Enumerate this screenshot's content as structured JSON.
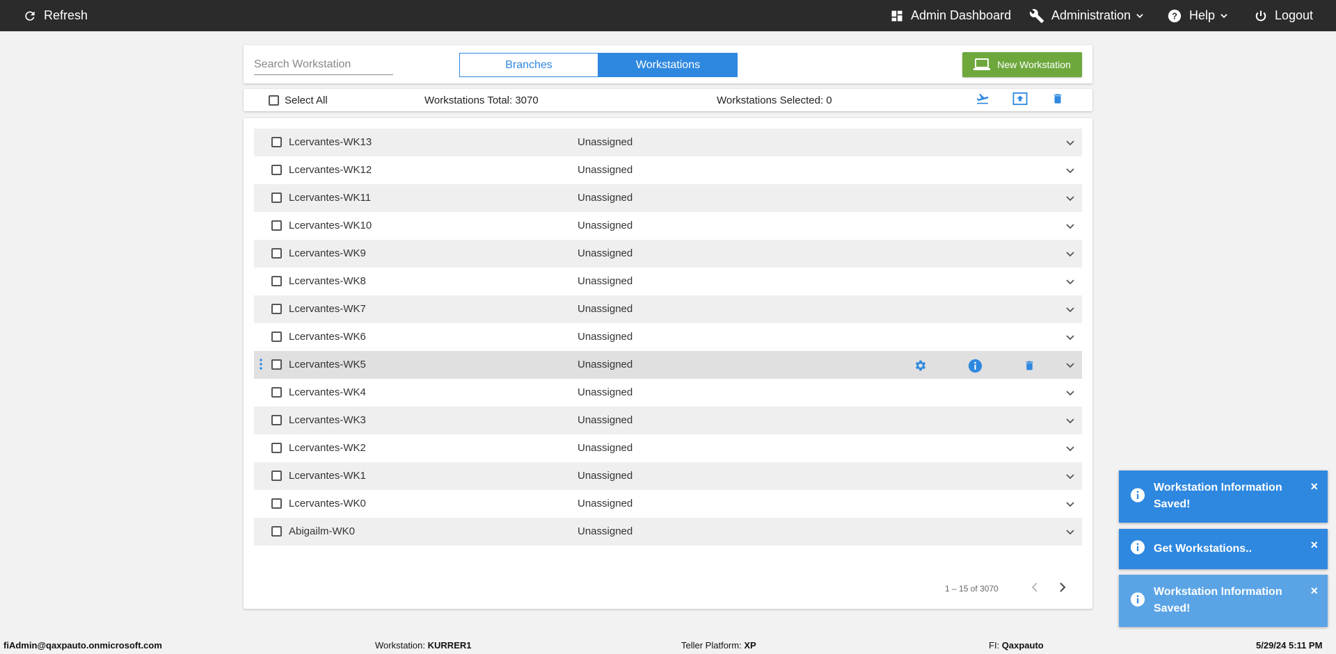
{
  "topbar": {
    "refresh_label": "Refresh",
    "admin_dashboard_label": "Admin Dashboard",
    "administration_label": "Administration",
    "help_label": "Help",
    "logout_label": "Logout"
  },
  "toolbar": {
    "search_placeholder": "Search Workstation",
    "branches_tab": "Branches",
    "workstations_tab": "Workstations",
    "active_tab": "Workstations",
    "new_workstation_label": "New Workstation"
  },
  "selection": {
    "select_all_label": "Select All",
    "total_label": "Workstations Total: 3070",
    "selected_label": "Workstations Selected: 0"
  },
  "rows": [
    {
      "name": "Lcervantes-WK13",
      "assignment": "Unassigned"
    },
    {
      "name": "Lcervantes-WK12",
      "assignment": "Unassigned"
    },
    {
      "name": "Lcervantes-WK11",
      "assignment": "Unassigned"
    },
    {
      "name": "Lcervantes-WK10",
      "assignment": "Unassigned"
    },
    {
      "name": "Lcervantes-WK9",
      "assignment": "Unassigned"
    },
    {
      "name": "Lcervantes-WK8",
      "assignment": "Unassigned"
    },
    {
      "name": "Lcervantes-WK7",
      "assignment": "Unassigned"
    },
    {
      "name": "Lcervantes-WK6",
      "assignment": "Unassigned"
    },
    {
      "name": "Lcervantes-WK5",
      "assignment": "Unassigned"
    },
    {
      "name": "Lcervantes-WK4",
      "assignment": "Unassigned"
    },
    {
      "name": "Lcervantes-WK3",
      "assignment": "Unassigned"
    },
    {
      "name": "Lcervantes-WK2",
      "assignment": "Unassigned"
    },
    {
      "name": "Lcervantes-WK1",
      "assignment": "Unassigned"
    },
    {
      "name": "Lcervantes-WK0",
      "assignment": "Unassigned"
    },
    {
      "name": "Abigailm-WK0",
      "assignment": "Unassigned"
    }
  ],
  "pagination": {
    "range_label": "1 – 15 of 3070"
  },
  "toasts": [
    {
      "line1": "Workstation Information",
      "line2": "Saved!",
      "close": "×"
    },
    {
      "line1": "Get Workstations..",
      "line2": "",
      "close": "×"
    },
    {
      "line1": "Workstation Information",
      "line2": "Saved!",
      "close": "×"
    }
  ],
  "footer": {
    "user": "fiAdmin@qaxpauto.onmicrosoft.com",
    "workstation_label": "Workstation:",
    "workstation_value": "KURRER1",
    "platform_label": "Teller Platform:",
    "platform_value": "XP",
    "fi_label": "FI:",
    "fi_value": "Qaxpauto",
    "datetime": "5/29/24 5:11 PM"
  },
  "colors": {
    "accent": "#2e88e0",
    "new_button": "#6ea83d",
    "topbar": "#2b2b2b",
    "toast": "#2e88e0",
    "toast_faded": "#5aa4e6"
  }
}
